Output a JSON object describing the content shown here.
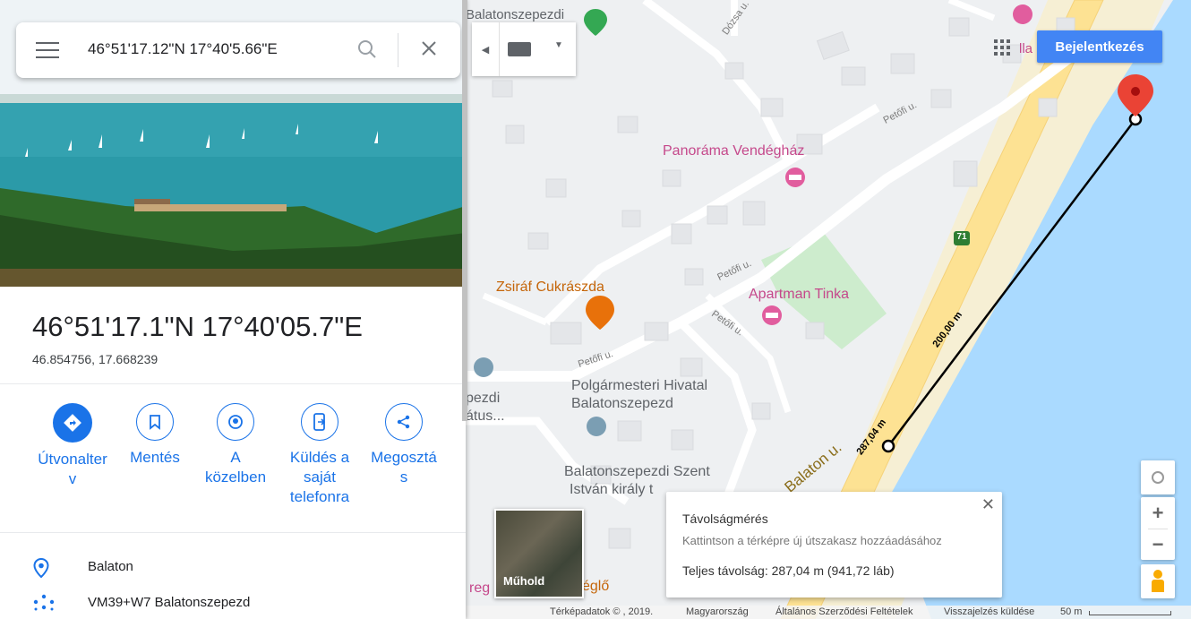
{
  "search": {
    "query": "46°51'17.12\"N 17°40'5.66\"E"
  },
  "place": {
    "title": "46°51'17.1\"N 17°40'05.7\"E",
    "decimal": "46.854756, 17.668239"
  },
  "actions": [
    {
      "label_lines": [
        "Útvonalter",
        "v"
      ],
      "icon": "directions-icon"
    },
    {
      "label_lines": [
        "Mentés"
      ],
      "icon": "bookmark-icon"
    },
    {
      "label_lines": [
        "A",
        "közelben"
      ],
      "icon": "nearby-icon"
    },
    {
      "label_lines": [
        "Küldés a",
        "saját",
        "telefonra"
      ],
      "icon": "send-to-phone-icon"
    },
    {
      "label_lines": [
        "Megosztá",
        "s"
      ],
      "icon": "share-icon"
    }
  ],
  "info": {
    "region": "Balaton",
    "plus_code": "VM39+W7 Balatonszepezd"
  },
  "map": {
    "login_button": "Bejelentkezés",
    "labels": {
      "top_place": "Balatonszepezdi",
      "dozsa": "Dózsa u.",
      "petofi": "Petőfi u.",
      "panorama": "Panoráma Vendégház",
      "zsiraf": "Zsiráf Cukrászda",
      "tinka": "Apartman Tinka",
      "polgar_1": "Polgármesteri Hivatal",
      "polgar_2": "Balatonszepezd",
      "church_1": "Balatonszepezdi Szent",
      "church_2": "István király t",
      "left_1": "pezdi",
      "left_2": "átus...",
      "balaton_u": "Balaton u.",
      "road_71": "71",
      "villa": "lla",
      "reg": "reg",
      "eglo": "églő",
      "dist_200": "200,00 m",
      "dist_287": "287,04 m"
    },
    "satellite_label": "Műhold"
  },
  "measure": {
    "title": "Távolságmérés",
    "hint": "Kattintson a térképre új útszakasz hozzáadásához",
    "total": "Teljes távolság: 287,04 m (941,72 láb)"
  },
  "footer": {
    "data": "Térképadatok © , 2019.",
    "country": "Magyarország",
    "terms": "Általános Szerződési Feltételek",
    "feedback": "Visszajelzés küldése",
    "scale": "50 m"
  },
  "colors": {
    "accent": "#1a73e8",
    "water": "#aadaff",
    "road_yellow": "#fde293",
    "pink": "#e15d9e",
    "orange": "#e8710a"
  }
}
